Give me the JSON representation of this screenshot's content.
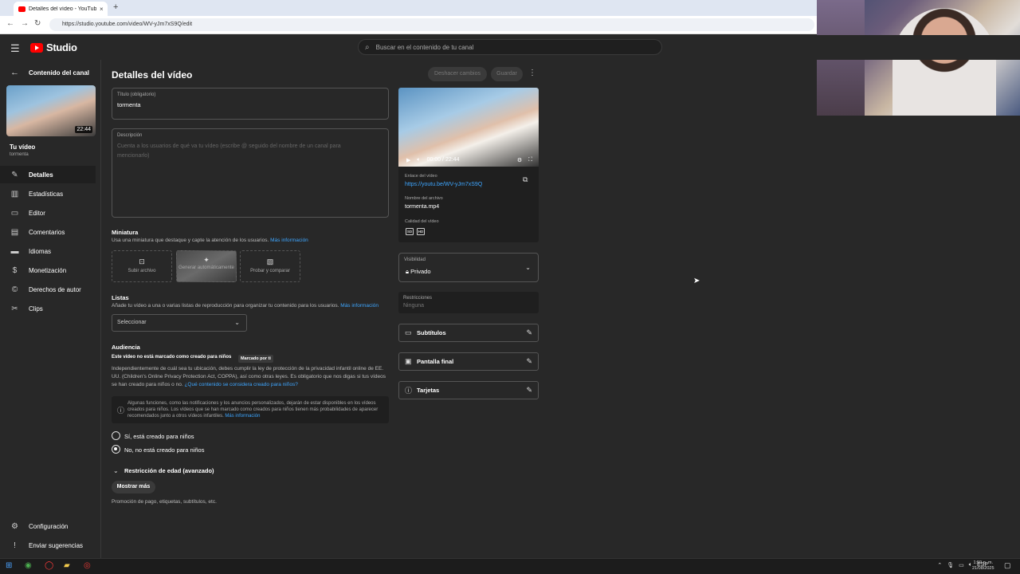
{
  "browser": {
    "tab_title": "Detalles del vídeo - YouTube Studio",
    "tab_close": "×",
    "new_tab": "+",
    "url": "https://studio.youtube.com/video/WV-yJm7xS9Q/edit"
  },
  "header": {
    "logo_text": "Studio",
    "search_placeholder": "Buscar en el contenido de tu canal"
  },
  "sidebar": {
    "back_label": "Contenido del canal",
    "thumb_duration": "22:44",
    "your_video": "Tu vídeo",
    "video_name": "tormenta",
    "items": [
      {
        "label": "Detalles",
        "icon": "pencil-icon"
      },
      {
        "label": "Estadísticas",
        "icon": "stats-icon"
      },
      {
        "label": "Editor",
        "icon": "editor-icon"
      },
      {
        "label": "Comentarios",
        "icon": "comments-icon"
      },
      {
        "label": "Idiomas",
        "icon": "subtitles-icon"
      },
      {
        "label": "Monetización",
        "icon": "dollar-icon"
      },
      {
        "label": "Derechos de autor",
        "icon": "copyright-icon"
      },
      {
        "label": "Clips",
        "icon": "scissors-icon"
      }
    ],
    "settings": "Configuración",
    "feedback": "Enviar sugerencias"
  },
  "main": {
    "title": "Detalles del vídeo",
    "undo": "Deshacer cambios",
    "save": "Guardar",
    "title_label": "Título (obligatorio)",
    "title_value": "tormenta",
    "desc_label": "Descripción",
    "desc_placeholder": "Cuenta a los usuarios de qué va tu vídeo (escribe @ seguido del nombre de un canal para mencionarlo)",
    "thumb_title": "Miniatura",
    "thumb_text": "Usa una miniatura que destaque y capte la atención de los usuarios.",
    "more_info": "Más información",
    "thumb_upload": "Subir archivo",
    "thumb_auto": "Generar automáticamente",
    "thumb_test": "Probar y comparar",
    "lists_title": "Listas",
    "lists_text": "Añade tu vídeo a una o varias listas de reproducción para organizar tu contenido para los usuarios.",
    "lists_select": "Seleccionar",
    "audience_title": "Audiencia",
    "audience_status": "Este vídeo no está marcado como creado para niños",
    "audience_badge": "Marcado por ti",
    "audience_text": "Independientemente de cuál sea tu ubicación, debes cumplir la ley de protección de la privacidad infantil online de EE. UU. (Children's Online Privacy Protection Act, COPPA), así como otras leyes. Es obligatorio que nos digas si tus vídeos se han creado para niños o no.",
    "audience_link": "¿Qué contenido se considera creado para niños?",
    "info_text": "Algunas funciones, como las notificaciones y los anuncios personalizados, dejarán de estar disponibles en los vídeos creados para niños. Los vídeos que se han marcado como creados para niños tienen más probabilidades de aparecer recomendados junto a otros vídeos infantiles.",
    "radio_yes": "Sí, está creado para niños",
    "radio_no": "No, no está creado para niños",
    "radio_selected": "no",
    "age_restriction": "Restricción de edad (avanzado)",
    "show_more": "Mostrar más",
    "show_more_text": "Promoción de pago, etiquetas, subtítulos, etc."
  },
  "player": {
    "time": "00:00 / 22:44",
    "link_label": "Enlace del vídeo",
    "link": "https://youtu.be/WV-yJm7xS9Q",
    "file_label": "Nombre del archivo",
    "file": "tormenta.mp4",
    "quality_label": "Calidad del vídeo",
    "quality_sd": "SD",
    "quality_hd": "HD"
  },
  "right": {
    "visibility_label": "Visibilidad",
    "visibility_value": "Privado",
    "restrictions_label": "Restricciones",
    "restrictions_value": "Ninguna",
    "subtitles": "Subtítulos",
    "end_screen": "Pantalla final",
    "cards": "Tarjetas"
  },
  "taskbar": {
    "lang": "ESP",
    "time": "1:59 p. m.",
    "date": "21/08/2025"
  }
}
